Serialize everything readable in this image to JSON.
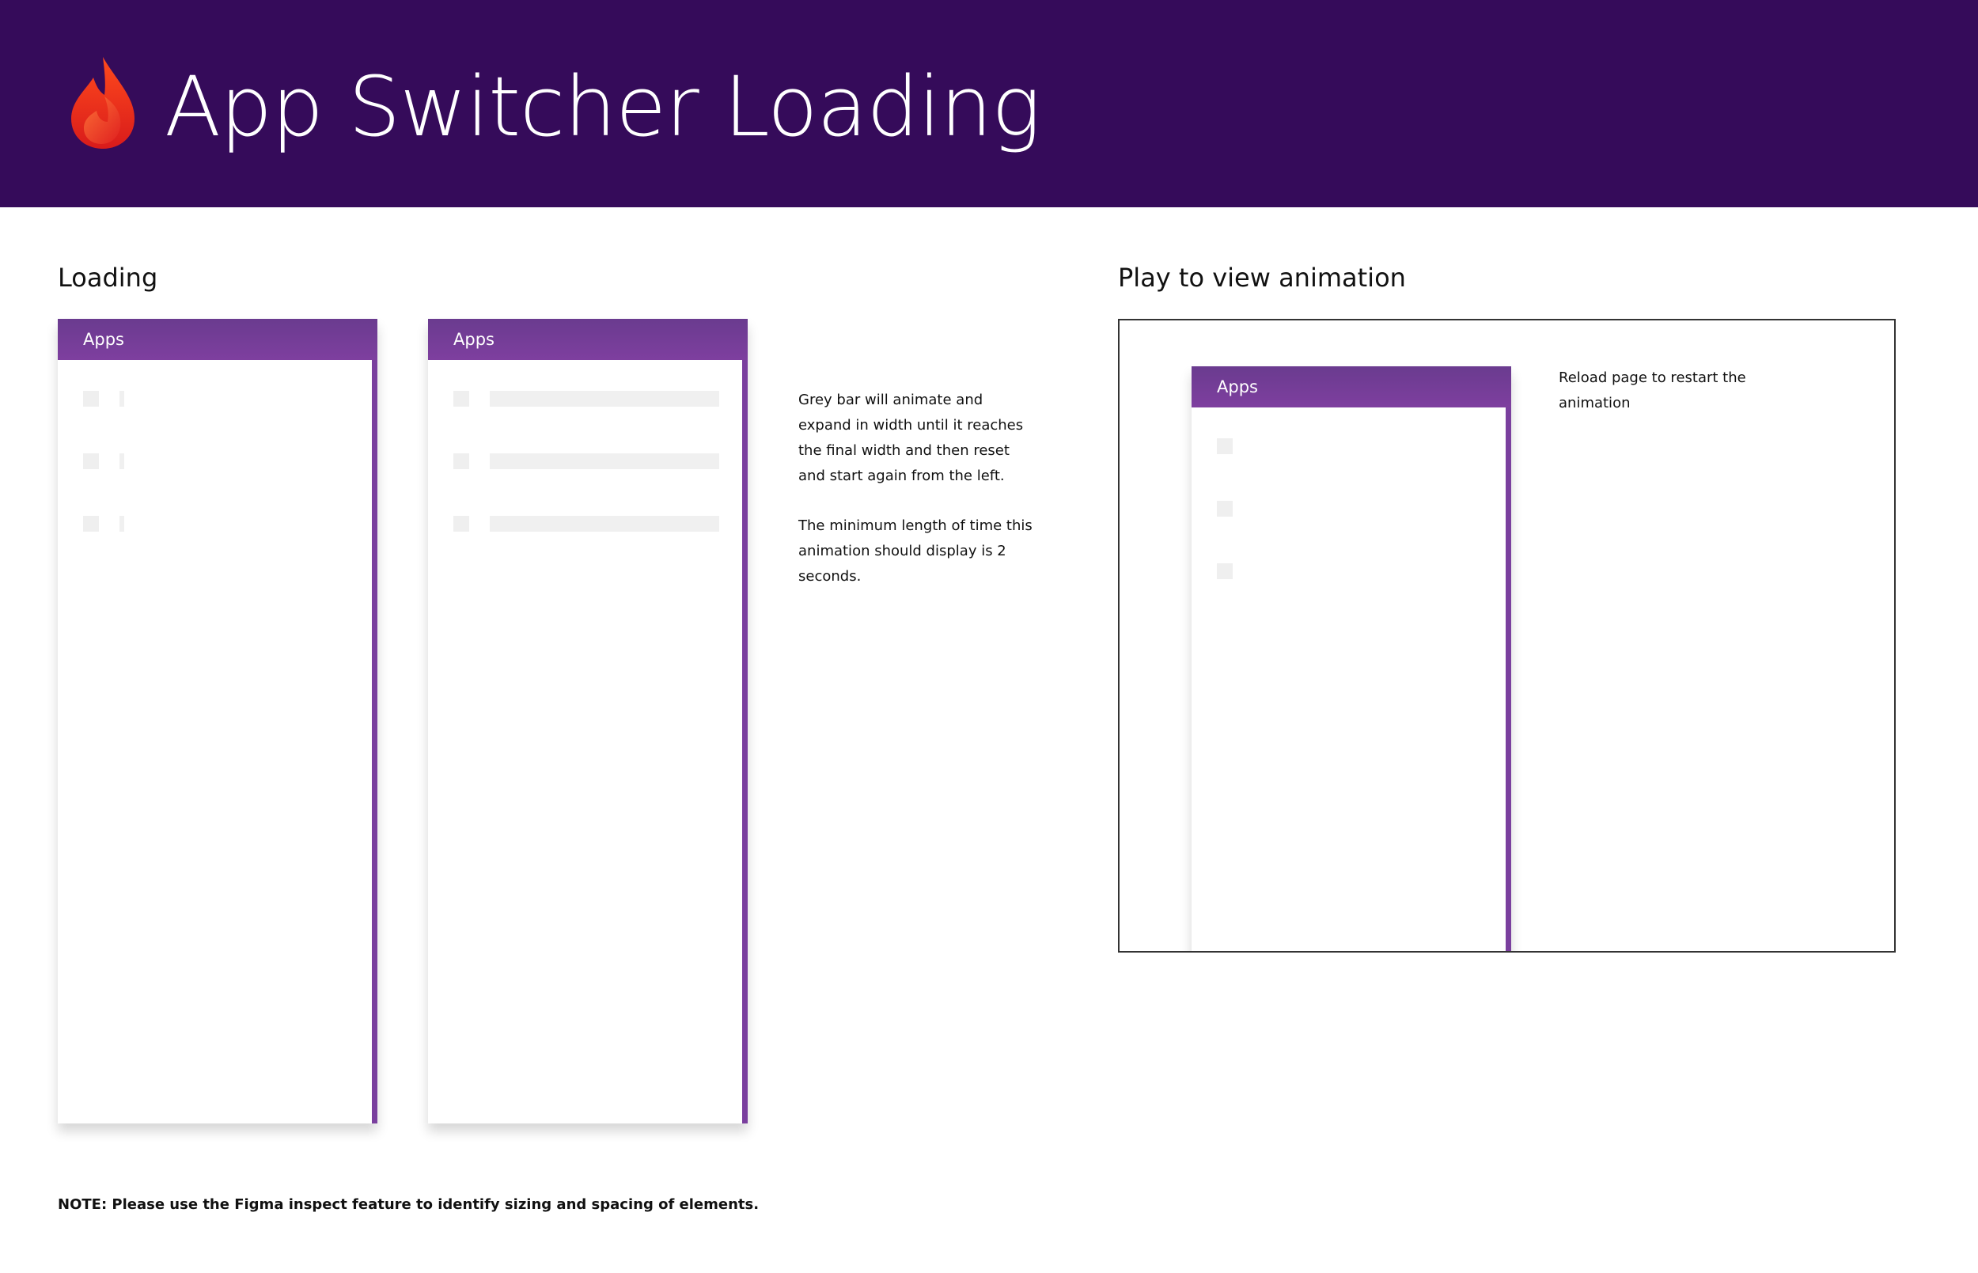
{
  "header": {
    "title": "App Switcher Loading",
    "logo_icon": "flame-icon",
    "background": "#350b5a"
  },
  "loading_section": {
    "title": "Loading",
    "panels": [
      {
        "header_label": "Apps",
        "state": "start"
      },
      {
        "header_label": "Apps",
        "state": "end"
      }
    ]
  },
  "description": {
    "paragraph_1": "Grey bar will animate and expand in width until it reaches the final width and then reset and start again from the left.",
    "paragraph_2": "The minimum length of time this animation should display is 2 seconds."
  },
  "animation_section": {
    "title": "Play to view animation",
    "panel_header_label": "Apps",
    "reload_note": "Reload page to restart the animation"
  },
  "footer": {
    "note": "NOTE: Please use the Figma inspect feature to identify sizing and spacing of elements."
  },
  "colors": {
    "accent": "#7a3f9e",
    "skeleton": "#efefef"
  }
}
